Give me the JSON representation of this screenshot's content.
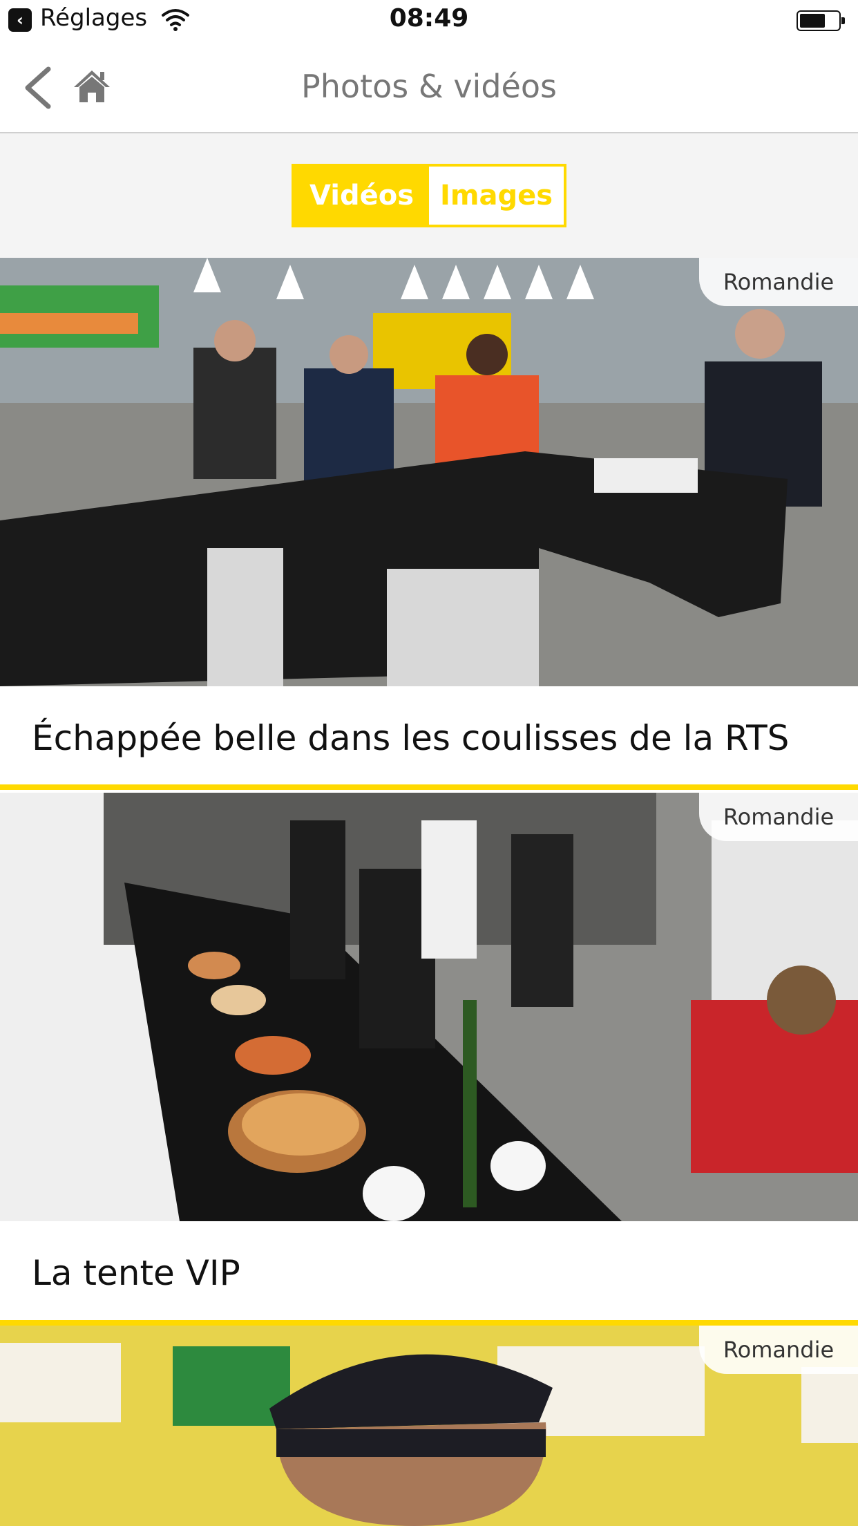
{
  "status": {
    "carrier": "Réglages",
    "time": "08:49"
  },
  "nav": {
    "title": "Photos & vidéos"
  },
  "segment": {
    "videos": "Vidéos",
    "images": "Images",
    "active": "videos"
  },
  "videos": [
    {
      "title": "Échappée belle dans les coulisses de la RTS",
      "logo": "Romandie"
    },
    {
      "title": "La tente VIP",
      "logo": "Romandie"
    },
    {
      "title": "",
      "logo": "Romandie"
    }
  ],
  "colors": {
    "accent": "#ffd900",
    "title_gray": "#777777"
  }
}
